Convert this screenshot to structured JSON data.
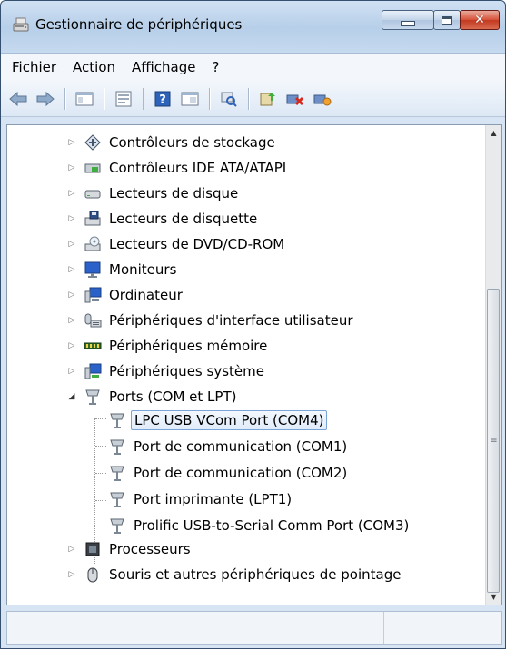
{
  "window": {
    "title": "Gestionnaire de périphériques",
    "close_glyph": "✕"
  },
  "menu": {
    "items": [
      "Fichier",
      "Action",
      "Affichage",
      "?"
    ]
  },
  "toolbar": {
    "icons": [
      "back-arrow-icon",
      "forward-arrow-icon",
      "show-hide-console-tree-icon",
      "properties-icon",
      "help-icon",
      "view-icon",
      "scan-hardware-changes-icon",
      "update-driver-icon",
      "uninstall-device-icon",
      "disable-device-icon"
    ]
  },
  "tree": {
    "items": [
      {
        "label": "Contrôleurs de stockage",
        "icon": "storage-controller-icon",
        "expander": "▷"
      },
      {
        "label": "Contrôleurs IDE ATA/ATAPI",
        "icon": "ide-controller-icon",
        "expander": "▷"
      },
      {
        "label": "Lecteurs de disque",
        "icon": "disk-drive-icon",
        "expander": "▷"
      },
      {
        "label": "Lecteurs de disquette",
        "icon": "floppy-drive-icon",
        "expander": "▷"
      },
      {
        "label": "Lecteurs de DVD/CD-ROM",
        "icon": "dvd-drive-icon",
        "expander": "▷"
      },
      {
        "label": "Moniteurs",
        "icon": "monitor-icon",
        "expander": "▷"
      },
      {
        "label": "Ordinateur",
        "icon": "computer-icon",
        "expander": "▷"
      },
      {
        "label": "Périphériques d'interface utilisateur",
        "icon": "hid-icon",
        "expander": "▷"
      },
      {
        "label": "Périphériques mémoire",
        "icon": "memory-icon",
        "expander": "▷"
      },
      {
        "label": "Périphériques système",
        "icon": "system-device-icon",
        "expander": "▷"
      },
      {
        "label": "Ports (COM et LPT)",
        "icon": "port-icon",
        "expander": "◢"
      }
    ],
    "ports_children": [
      {
        "label": "LPC USB VCom Port (COM4)",
        "icon": "port-icon",
        "selected": true
      },
      {
        "label": "Port de communication (COM1)",
        "icon": "port-icon",
        "selected": false
      },
      {
        "label": "Port de communication (COM2)",
        "icon": "port-icon",
        "selected": false
      },
      {
        "label": "Port imprimante (LPT1)",
        "icon": "port-icon",
        "selected": false
      },
      {
        "label": "Prolific USB-to-Serial Comm Port (COM3)",
        "icon": "port-icon",
        "selected": false
      }
    ],
    "bottom_items": [
      {
        "label": "Processeurs",
        "icon": "processor-icon",
        "expander": "▷"
      },
      {
        "label": "Souris et autres périphériques de pointage",
        "icon": "mouse-icon",
        "expander": "▷"
      }
    ]
  },
  "scrollbar": {
    "up_glyph": "▲",
    "down_glyph": "▼",
    "grip_glyph": "≡"
  },
  "colors": {
    "title_gradient_top": "#cfe0f3",
    "selection_border": "#7aa3d8",
    "close_button": "#c2391f"
  }
}
